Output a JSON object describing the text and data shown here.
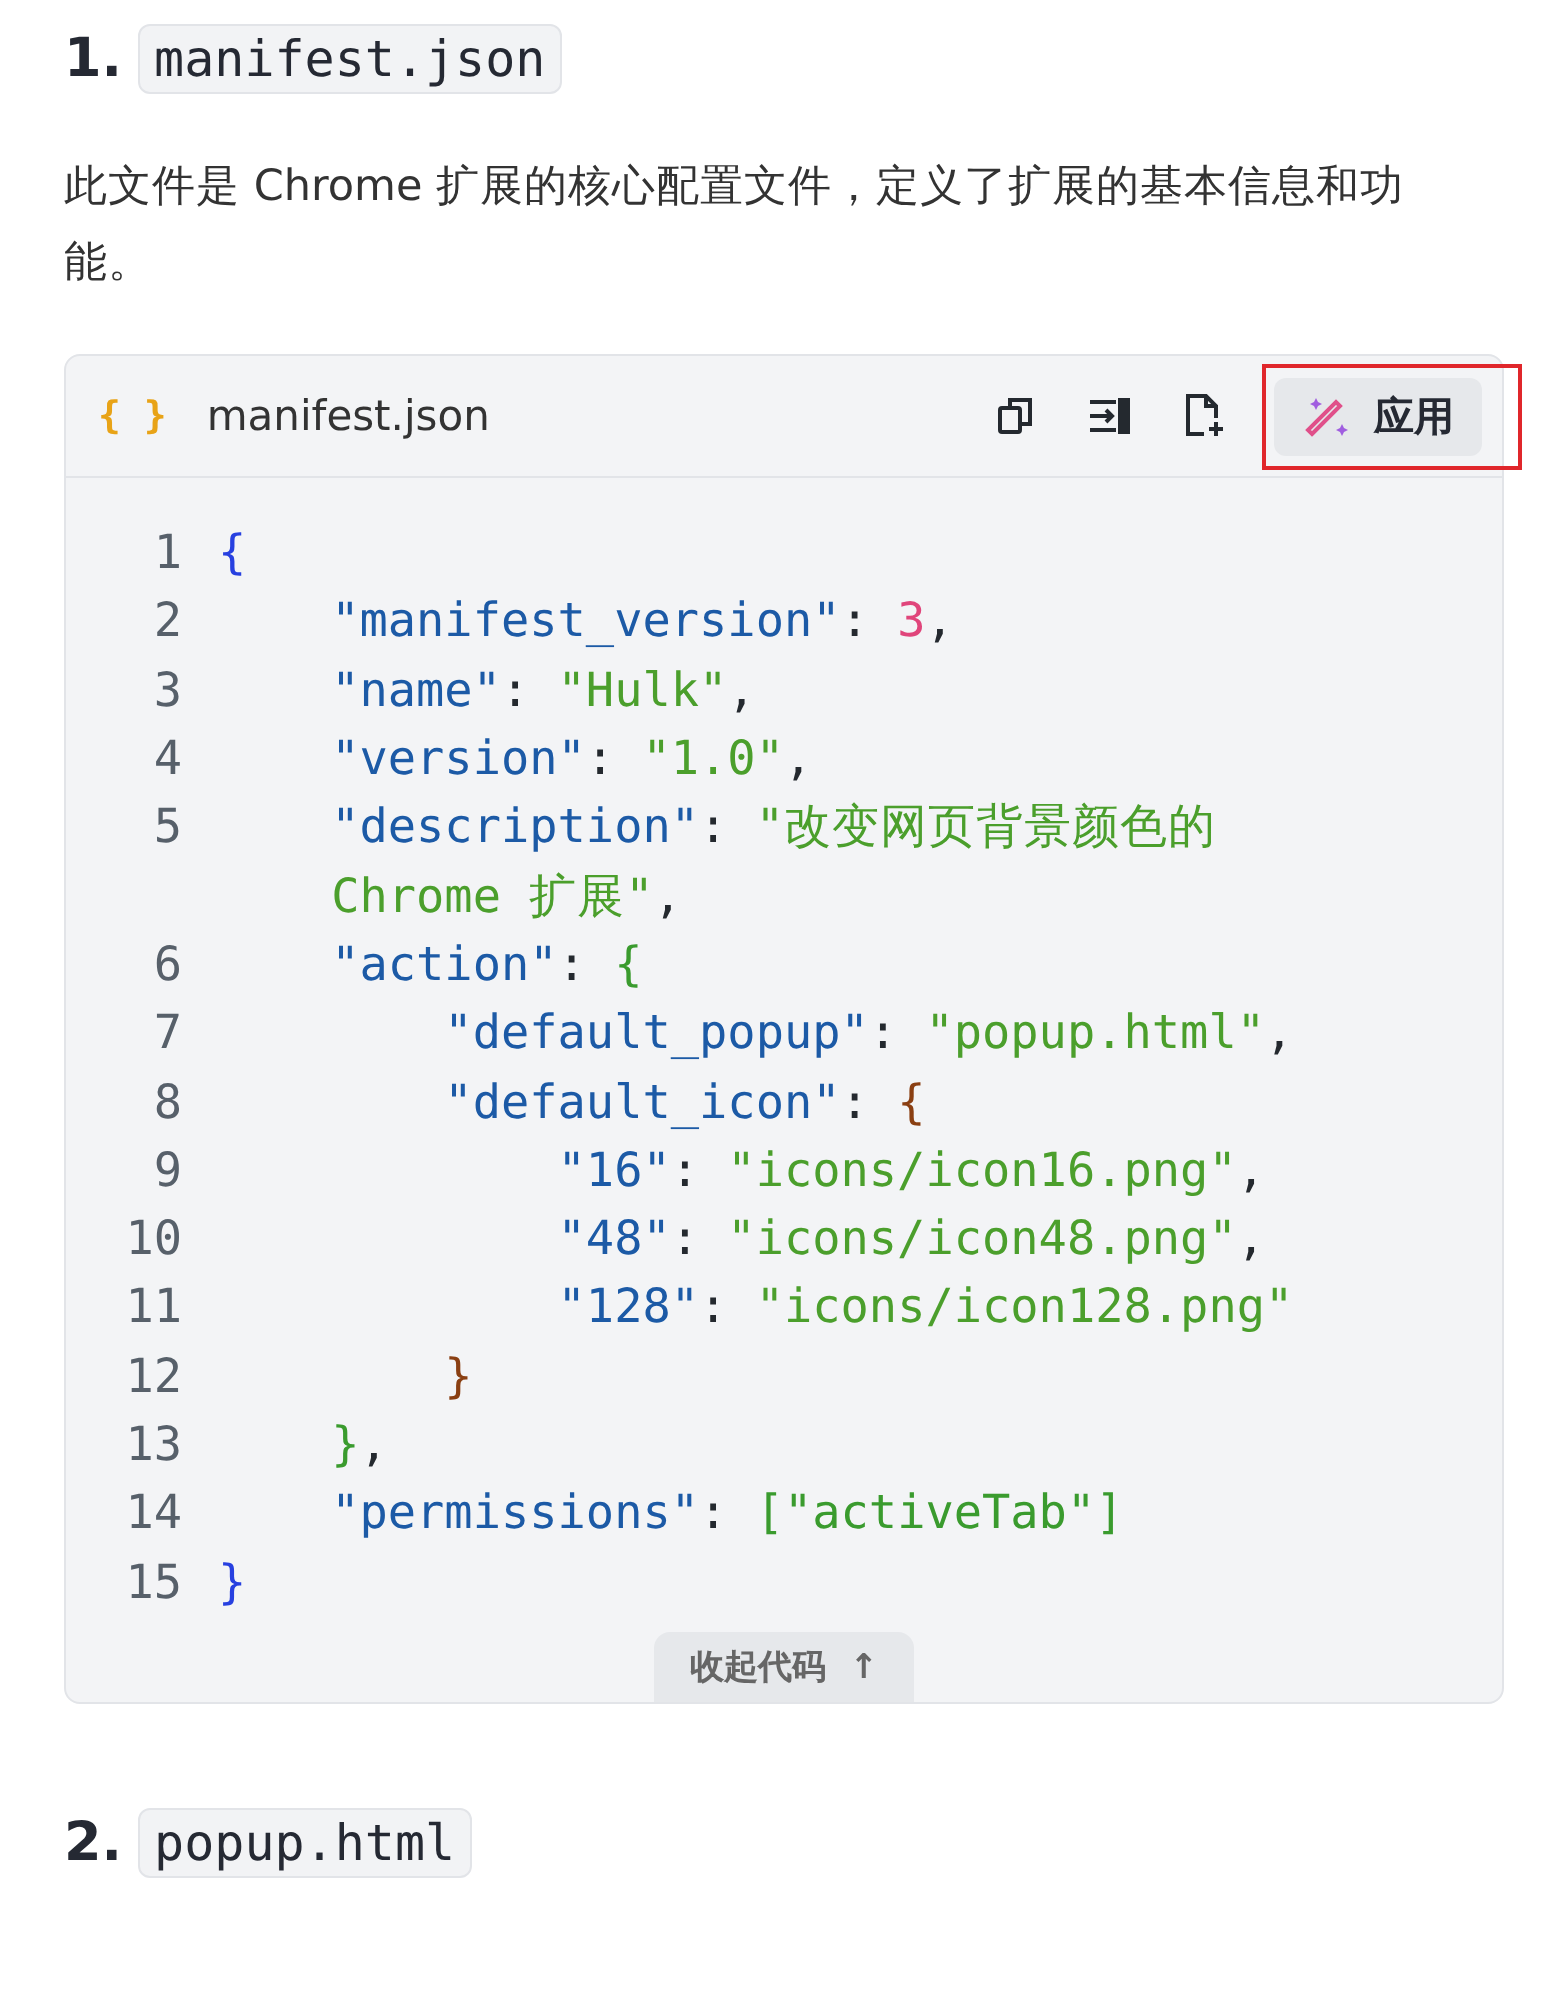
{
  "heading_1": {
    "number": "1.",
    "code": "manifest.json"
  },
  "paragraph": "此文件是 Chrome 扩展的核心配置文件，定义了扩展的基本信息和功能。",
  "code_block": {
    "brace_icon": "{ }",
    "filename": "manifest.json",
    "apply_button": {
      "label": "应用",
      "highlighted": true
    },
    "lines": [
      {
        "number": "1",
        "tokens": [
          {
            "kind": "brace1",
            "text": "{"
          }
        ]
      },
      {
        "number": "2",
        "tokens": [
          {
            "kind": "key",
            "text": "    \"manifest_version\""
          },
          {
            "kind": "punct",
            "text": ": "
          },
          {
            "kind": "number",
            "text": "3"
          },
          {
            "kind": "punct",
            "text": ","
          }
        ]
      },
      {
        "number": "3",
        "tokens": [
          {
            "kind": "key",
            "text": "    \"name\""
          },
          {
            "kind": "punct",
            "text": ": "
          },
          {
            "kind": "string",
            "text": "\"Hulk\""
          },
          {
            "kind": "punct",
            "text": ","
          }
        ]
      },
      {
        "number": "4",
        "tokens": [
          {
            "kind": "key",
            "text": "    \"version\""
          },
          {
            "kind": "punct",
            "text": ": "
          },
          {
            "kind": "string",
            "text": "\"1.0\""
          },
          {
            "kind": "punct",
            "text": ","
          }
        ]
      },
      {
        "number": "5",
        "tokens": [
          {
            "kind": "key",
            "text": "    \"description\""
          },
          {
            "kind": "punct",
            "text": ": "
          },
          {
            "kind": "string",
            "text": "\"改变网页背景颜色的"
          }
        ]
      },
      {
        "tokens": [
          {
            "kind": "string",
            "text": "    Chrome 扩展\""
          },
          {
            "kind": "punct",
            "text": ","
          }
        ]
      },
      {
        "number": "6",
        "tokens": [
          {
            "kind": "key",
            "text": "    \"action\""
          },
          {
            "kind": "punct",
            "text": ": "
          },
          {
            "kind": "brace2",
            "text": "{"
          }
        ]
      },
      {
        "number": "7",
        "tokens": [
          {
            "kind": "key",
            "text": "        \"default_popup\""
          },
          {
            "kind": "punct",
            "text": ": "
          },
          {
            "kind": "string",
            "text": "\"popup.html\""
          },
          {
            "kind": "punct",
            "text": ","
          }
        ]
      },
      {
        "number": "8",
        "tokens": [
          {
            "kind": "key",
            "text": "        \"default_icon\""
          },
          {
            "kind": "punct",
            "text": ": "
          },
          {
            "kind": "brace3",
            "text": "{"
          }
        ]
      },
      {
        "number": "9",
        "tokens": [
          {
            "kind": "key",
            "text": "            \"16\""
          },
          {
            "kind": "punct",
            "text": ": "
          },
          {
            "kind": "string",
            "text": "\"icons/icon16.png\""
          },
          {
            "kind": "punct",
            "text": ","
          }
        ]
      },
      {
        "number": "10",
        "tokens": [
          {
            "kind": "key",
            "text": "            \"48\""
          },
          {
            "kind": "punct",
            "text": ": "
          },
          {
            "kind": "string",
            "text": "\"icons/icon48.png\""
          },
          {
            "kind": "punct",
            "text": ","
          }
        ]
      },
      {
        "number": "11",
        "tokens": [
          {
            "kind": "key",
            "text": "            \"128\""
          },
          {
            "kind": "punct",
            "text": ": "
          },
          {
            "kind": "string",
            "text": "\"icons/icon128.png\""
          }
        ]
      },
      {
        "number": "12",
        "tokens": [
          {
            "kind": "brace3",
            "text": "        }"
          }
        ]
      },
      {
        "number": "13",
        "tokens": [
          {
            "kind": "brace2",
            "text": "    }"
          },
          {
            "kind": "punct",
            "text": ","
          }
        ]
      },
      {
        "number": "14",
        "tokens": [
          {
            "kind": "key",
            "text": "    \"permissions\""
          },
          {
            "kind": "punct",
            "text": ": "
          },
          {
            "kind": "brace2",
            "text": "[\"activeTab\"]"
          }
        ]
      },
      {
        "number": "15",
        "tokens": [
          {
            "kind": "brace1",
            "text": "}"
          }
        ]
      }
    ],
    "collapse_button": {
      "label": "收起代码",
      "arrow": "↑"
    }
  },
  "heading_2": {
    "number": "2.",
    "code": "popup.html"
  }
}
